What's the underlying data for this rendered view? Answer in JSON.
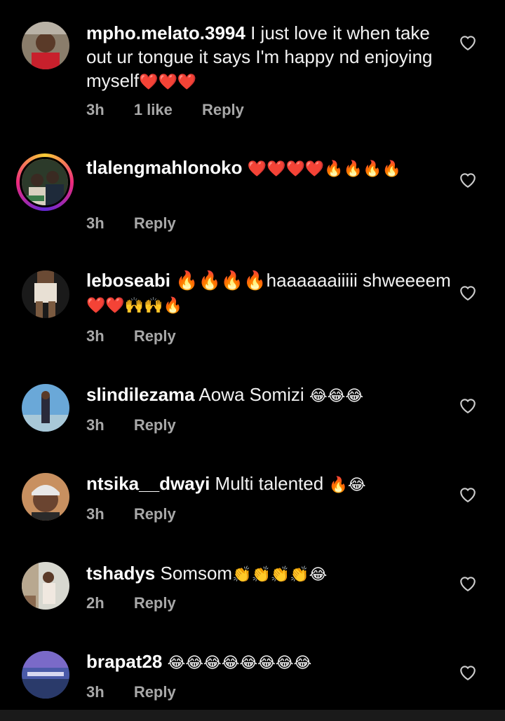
{
  "comments": [
    {
      "username": "mpho.melato.3994",
      "text": "I just love it when take out ur tongue it says I'm happy nd enjoying myself",
      "emoji": "❤️❤️❤️",
      "time": "3h",
      "likes": "1 like",
      "reply": "Reply"
    },
    {
      "username": "tlalengmahlonoko",
      "text": "",
      "emoji": "❤️❤️❤️❤️🔥🔥🔥🔥",
      "time": "3h",
      "reply": "Reply"
    },
    {
      "username": "leboseabi",
      "text": "🔥🔥🔥🔥haaaaaaiiiii shweeeem",
      "emoji": "❤️❤️🙌🙌🔥",
      "time": "3h",
      "reply": "Reply"
    },
    {
      "username": "slindilezama",
      "text": "Aowa Somizi",
      "emoji": "😂😂😂",
      "time": "3h",
      "reply": "Reply"
    },
    {
      "username": "ntsika__dwayi",
      "text": "Multi talented",
      "emoji": "🔥😂",
      "time": "3h",
      "reply": "Reply"
    },
    {
      "username": "tshadys",
      "text": "Somsom",
      "emoji": "👏👏👏👏😂",
      "time": "2h",
      "reply": "Reply"
    },
    {
      "username": "brapat28",
      "text": "",
      "emoji": "😂😂😂😂😂😂😂😂",
      "time": "3h",
      "reply": "Reply"
    }
  ],
  "icons": {
    "like": "heart-outline-icon"
  }
}
